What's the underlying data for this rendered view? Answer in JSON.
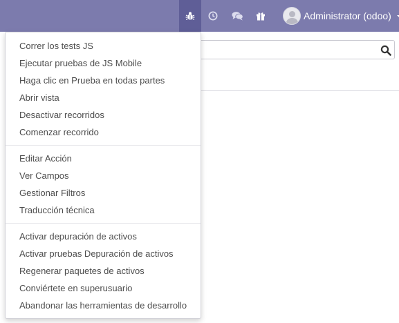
{
  "topbar": {
    "debug_icon": "bug-icon",
    "activity_icon": "clock-icon",
    "messaging_icon": "comments-icon",
    "gift_icon": "gift-icon",
    "user_name": "Administrator (odoo)",
    "colors": {
      "bar": "#7c7bad",
      "active": "#5f5e97"
    }
  },
  "search": {
    "icon": "search-icon"
  },
  "debug_menu": {
    "tests": [
      {
        "label": "Correr los tests JS"
      },
      {
        "label": "Ejecutar pruebas de JS Mobile"
      },
      {
        "label": "Haga clic en Prueba en todas partes"
      },
      {
        "label": "Abrir vista"
      },
      {
        "label": "Desactivar recorridos"
      },
      {
        "label": "Comenzar recorrido"
      }
    ],
    "view": [
      {
        "label": "Editar Acción"
      },
      {
        "label": "Ver Campos"
      },
      {
        "label": "Gestionar Filtros"
      },
      {
        "label": "Traducción técnica"
      }
    ],
    "assets": [
      {
        "label": "Activar depuración de activos"
      },
      {
        "label": "Activar pruebas Depuración de activos"
      },
      {
        "label": "Regenerar paquetes de activos"
      },
      {
        "label": "Conviértete en superusuario"
      },
      {
        "label": "Abandonar las herramientas de desarrollo"
      }
    ]
  }
}
